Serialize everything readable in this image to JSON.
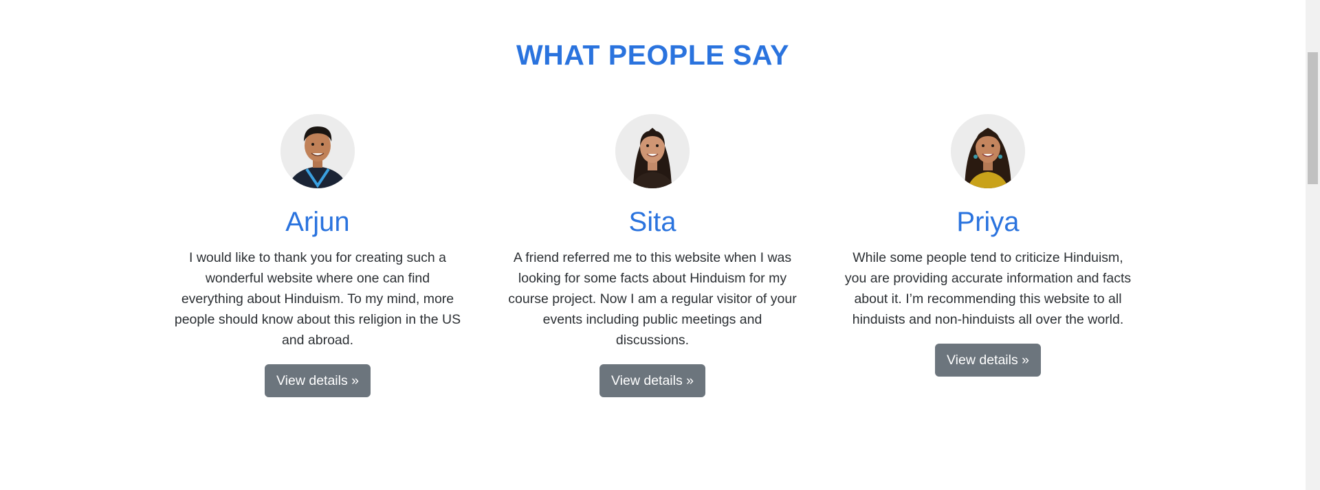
{
  "section": {
    "title": "WHAT PEOPLE SAY"
  },
  "testimonials": [
    {
      "name": "Arjun",
      "quote": "I would like to thank you for creating such a wonderful website where one can find everything about Hinduism. To my mind, more people should know about this religion in the US and abroad.",
      "button_label": "View details »"
    },
    {
      "name": "Sita",
      "quote": "A friend referred me to this website when I was looking for some facts about Hinduism for my course project. Now I am a regular visitor of your events including public meetings and discussions.",
      "button_label": "View details »"
    },
    {
      "name": "Priya",
      "quote": "While some people tend to criticize Hinduism, you are providing accurate information and facts about it. I’m recommending this website to all hinduists and non-hinduists all over the world.",
      "button_label": "View details »"
    }
  ],
  "colors": {
    "accent": "#2a73de",
    "button": "#6c757d",
    "text": "#2b2f33"
  }
}
